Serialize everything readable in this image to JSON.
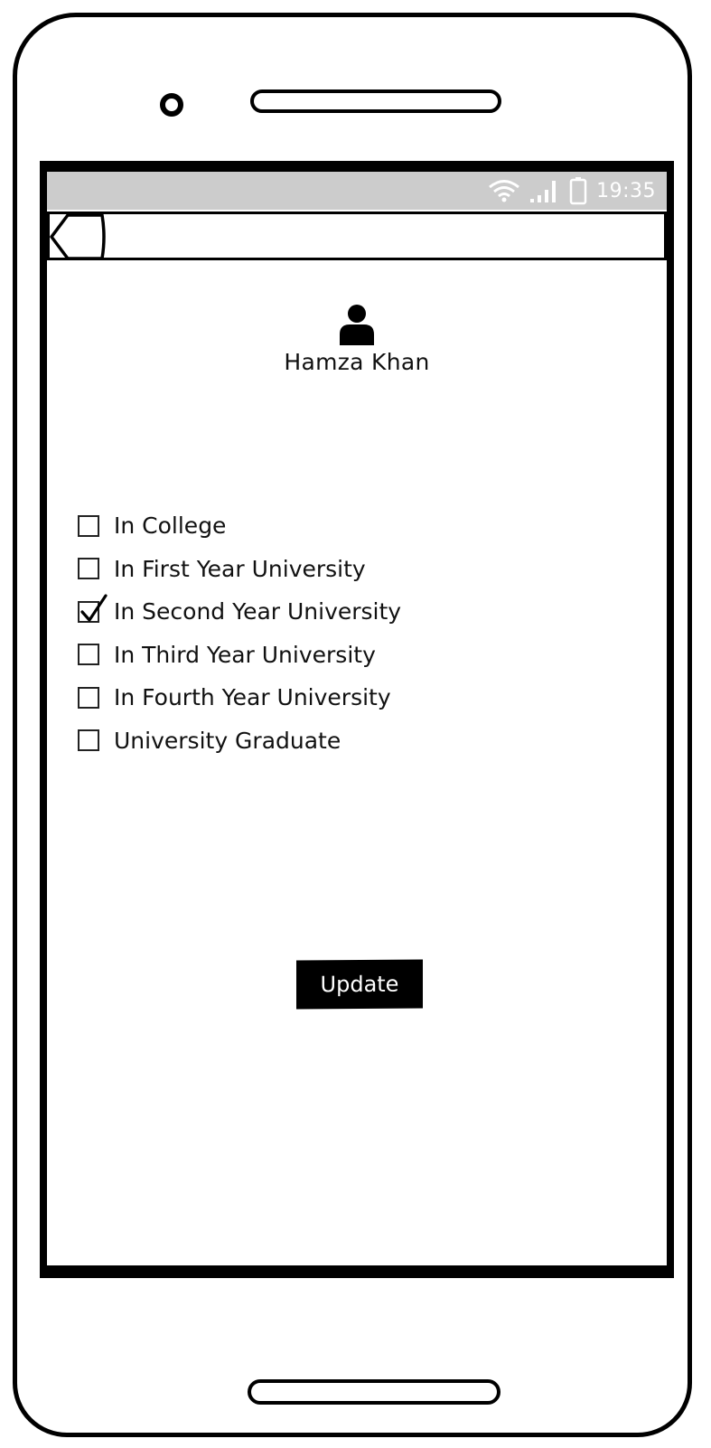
{
  "status_bar": {
    "time": "19:35",
    "icons": [
      "wifi-icon",
      "signal-icon",
      "battery-icon"
    ]
  },
  "app_bar": {
    "back_icon": "back-arrow-icon"
  },
  "profile": {
    "avatar_icon": "user-icon",
    "name": "Hamza Khan"
  },
  "education_status": {
    "options": [
      {
        "label": "In College",
        "checked": false
      },
      {
        "label": "In First Year University",
        "checked": false
      },
      {
        "label": "In Second Year University",
        "checked": true
      },
      {
        "label": "In Third Year University",
        "checked": false
      },
      {
        "label": "In Fourth Year University",
        "checked": false
      },
      {
        "label": "University Graduate",
        "checked": false
      }
    ]
  },
  "actions": {
    "update_label": "Update"
  },
  "colors": {
    "status_bar_bg": "#cccccc",
    "button_bg": "#000000",
    "button_text": "#ffffff"
  }
}
